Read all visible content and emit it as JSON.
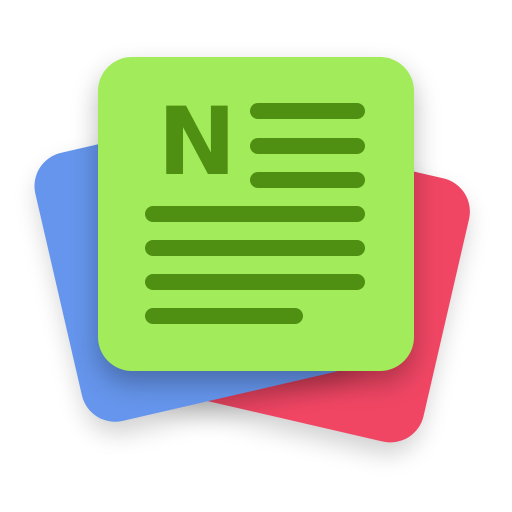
{
  "app_icon": {
    "name": "news-app",
    "letter": "N",
    "colors": {
      "back_card_red": "#f04664",
      "back_card_blue": "#6595ec",
      "front_card_green": "#a2ec5c",
      "ink": "#4f8f12"
    },
    "header_lines_count": 3,
    "body_lines_count": 4
  }
}
